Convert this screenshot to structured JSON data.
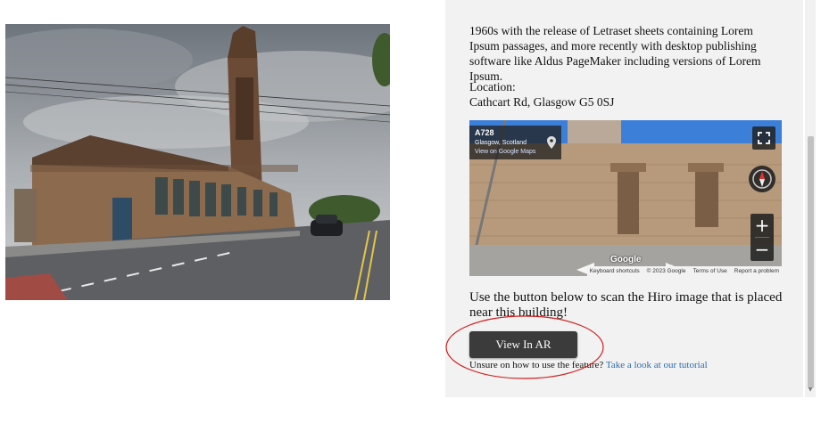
{
  "photo": {
    "alt_subject": "building-photo"
  },
  "content": {
    "description": "1960s with the release of Letraset sheets containing Lorem Ipsum passages, and more recently with desktop publishing software like Aldus PageMaker including versions of Lorem Ipsum.",
    "location_label": "Location:",
    "location_value": "Cathcart Rd, Glasgow G5 0SJ",
    "instruction": "Use the button below to scan the Hiro image that is placed near this building!",
    "ar_button_label": "View In AR",
    "help_text": "Unsure on how to use the feature?",
    "help_link": "Take a look at our tutorial"
  },
  "streetview": {
    "road": "A728",
    "city": "Glasgow, Scotland",
    "link": "View on Google Maps",
    "logo": "Google",
    "zoom_in": "+",
    "zoom_out": "−",
    "footer": [
      "Keyboard shortcuts",
      "© 2023 Google",
      "Terms of Use",
      "Report a problem"
    ]
  },
  "colors": {
    "panel_bg": "#f2f2f2",
    "button_bg": "#3b3b3b",
    "link": "#2b6cb0",
    "annotation": "#d11f1f"
  },
  "icons": [
    "pin-icon",
    "fullscreen-icon",
    "compass-icon",
    "scroll-down-icon"
  ]
}
